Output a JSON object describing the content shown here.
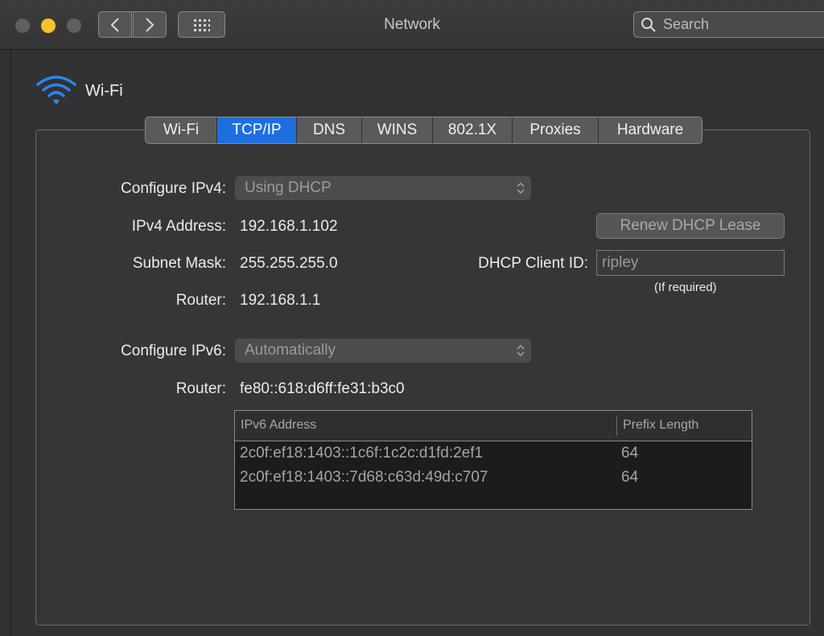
{
  "window": {
    "title": "Network",
    "search_placeholder": "Search",
    "accent_color": "#1d6fe0"
  },
  "interface": {
    "name": "Wi-Fi",
    "icon": "wifi-icon"
  },
  "tabs": [
    {
      "label": "Wi-Fi",
      "active": false
    },
    {
      "label": "TCP/IP",
      "active": true
    },
    {
      "label": "DNS",
      "active": false
    },
    {
      "label": "WINS",
      "active": false
    },
    {
      "label": "802.1X",
      "active": false
    },
    {
      "label": "Proxies",
      "active": false
    },
    {
      "label": "Hardware",
      "active": false
    }
  ],
  "ipv4": {
    "configure_label": "Configure IPv4:",
    "configure_value": "Using DHCP",
    "address_label": "IPv4 Address:",
    "address_value": "192.168.1.102",
    "subnet_label": "Subnet Mask:",
    "subnet_value": "255.255.255.0",
    "router_label": "Router:",
    "router_value": "192.168.1.1",
    "renew_button": "Renew DHCP Lease",
    "client_id_label": "DHCP Client ID:",
    "client_id_value": "ripley",
    "client_id_hint": "(If required)"
  },
  "ipv6": {
    "configure_label": "Configure IPv6:",
    "configure_value": "Automatically",
    "router_label": "Router:",
    "router_value": "fe80::618:d6ff:fe31:b3c0",
    "table": {
      "columns": [
        "IPv6 Address",
        "Prefix Length"
      ],
      "rows": [
        {
          "address": "2c0f:ef18:1403::1c6f:1c2c:d1fd:2ef1",
          "prefix": "64"
        },
        {
          "address": "2c0f:ef18:1403::7d68:c63d:49d:c707",
          "prefix": "64"
        }
      ]
    }
  }
}
